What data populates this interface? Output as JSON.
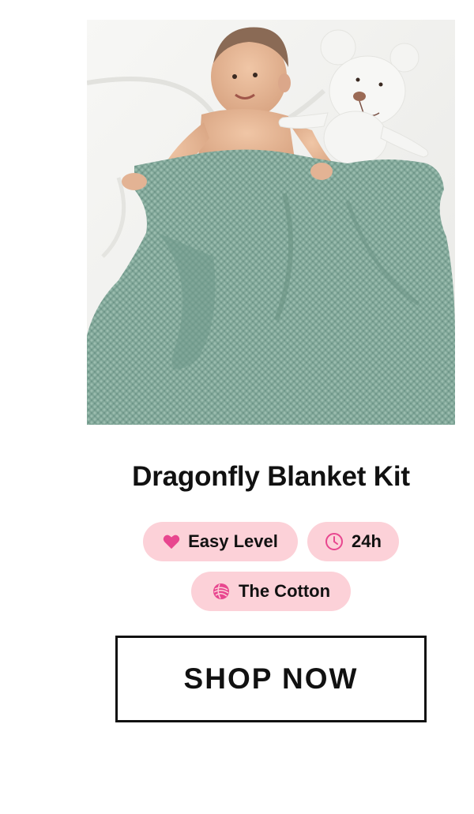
{
  "product": {
    "title": "Dragonfly Blanket Kit",
    "image_alt": "Baby lying under a sage green knitted blanket next to a white plush mouse"
  },
  "chips": [
    {
      "icon": "heart-icon",
      "label": "Easy Level"
    },
    {
      "icon": "clock-icon",
      "label": "24h"
    },
    {
      "icon": "yarn-ball-icon",
      "label": "The Cotton"
    }
  ],
  "cta": {
    "label": "SHOP NOW"
  },
  "colors": {
    "chip_bg": "#fcd1d8",
    "chip_icon": "#e8468f",
    "blanket": "#7fa89a",
    "text": "#111111"
  }
}
